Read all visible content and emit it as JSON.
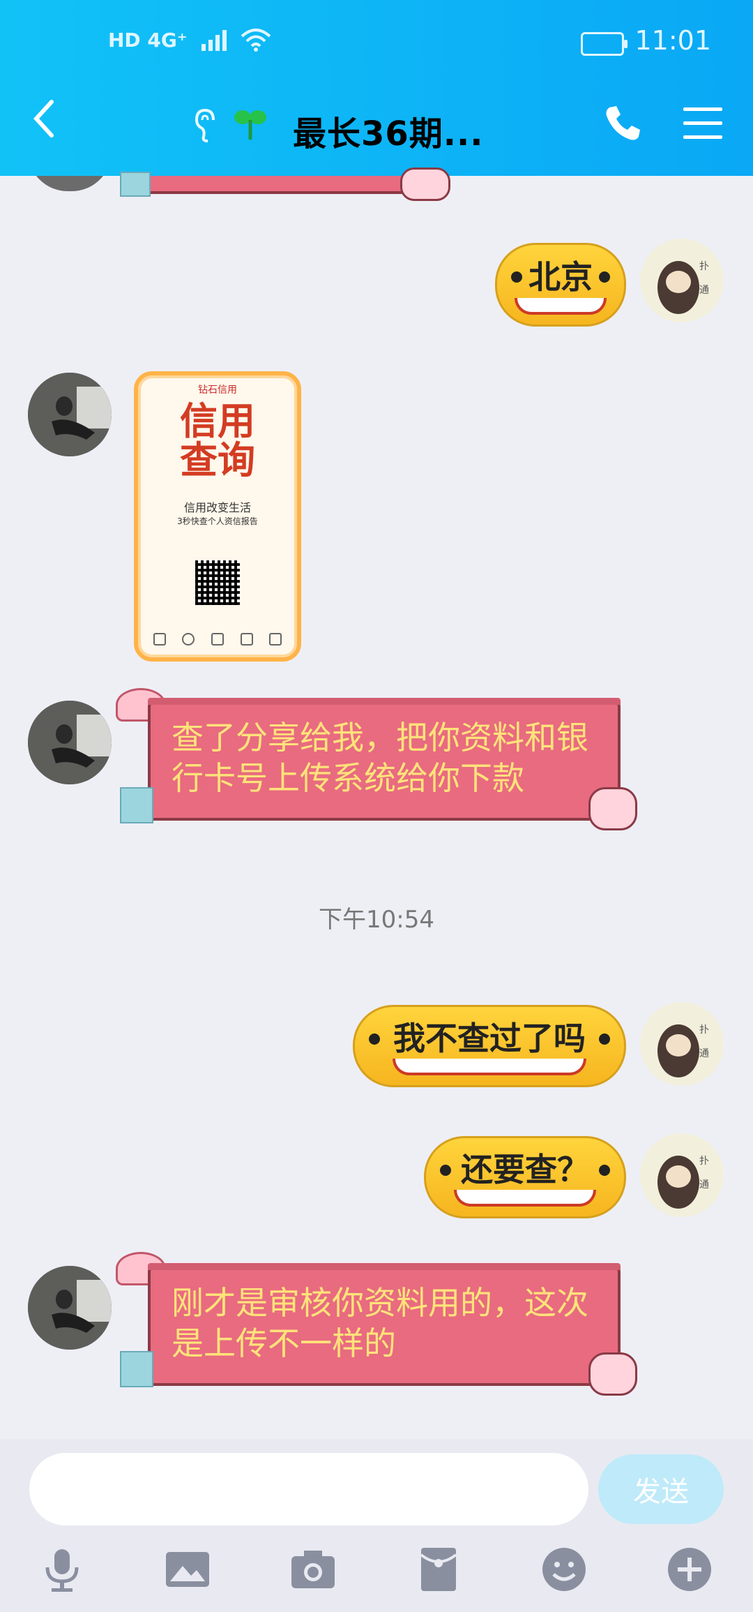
{
  "status_bar": {
    "network": "HD 4G⁺",
    "time": "11:01"
  },
  "header": {
    "title": "最长36期...",
    "ear_icon": "ear-icon",
    "sprout_icon": "sprout-icon"
  },
  "messages": {
    "m1": {
      "text": "北京"
    },
    "m2_card": {
      "brand": "钻石信用",
      "big1": "信用",
      "big2": "查询",
      "line1": "信用改变生活",
      "line2": "3秒快查个人资信报告"
    },
    "m3": {
      "text": "查了分享给我，把你资料和银行卡号上传系统给你下款"
    },
    "timestamp": "下午10:54",
    "m4": {
      "text": "我不查过了吗"
    },
    "m5": {
      "text": "还要查？"
    },
    "m6": {
      "text": "刚才是审核你资料用的，这次是上传不一样的"
    }
  },
  "input": {
    "placeholder": "",
    "send_label": "发送"
  },
  "toolbar": [
    "mic-icon",
    "image-icon",
    "camera-icon",
    "red-packet-icon",
    "emoji-icon",
    "plus-icon"
  ],
  "colors": {
    "header": "#0aa8f5",
    "pink_bubble": "#e86b80",
    "pink_text": "#ffe37a",
    "send_disabled": "#bfeaf9"
  }
}
